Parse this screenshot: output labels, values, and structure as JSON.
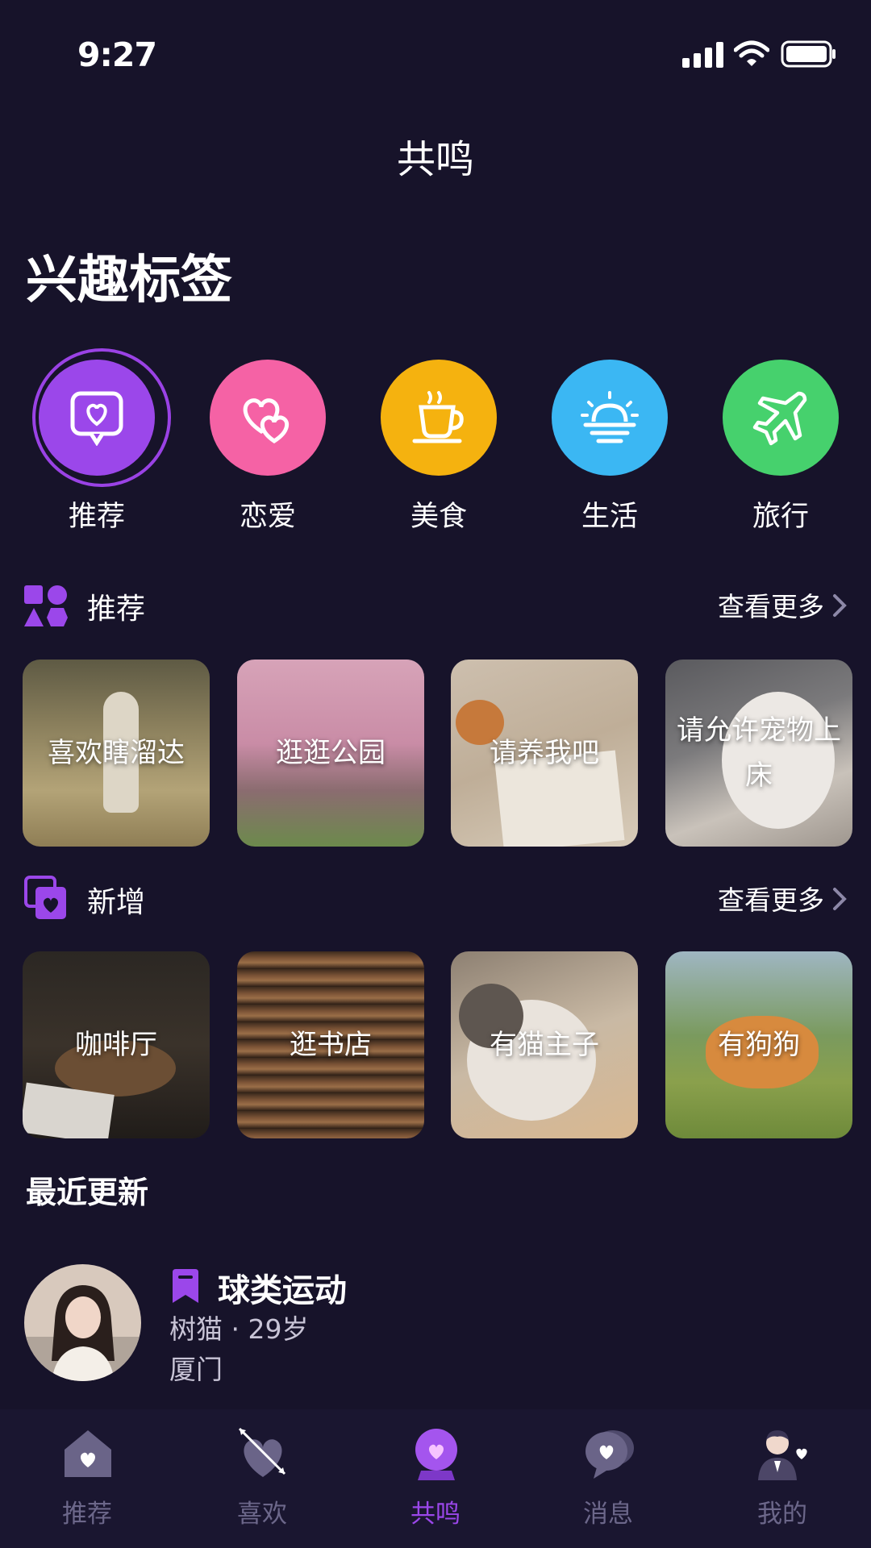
{
  "status_bar": {
    "time": "9:27"
  },
  "nav": {
    "title": "共鸣"
  },
  "interest": {
    "heading": "兴趣标签",
    "categories": [
      {
        "label": "推荐",
        "color": "#9b47ea",
        "icon": "heart-chat-icon",
        "selected": true
      },
      {
        "label": "恋爱",
        "color": "#f562a5",
        "icon": "double-heart-icon"
      },
      {
        "label": "美食",
        "color": "#f5b20f",
        "icon": "coffee-cup-icon"
      },
      {
        "label": "生活",
        "color": "#3bb7f3",
        "icon": "sunrise-icon"
      },
      {
        "label": "旅行",
        "color": "#46d16d",
        "icon": "airplane-icon"
      }
    ]
  },
  "recommend": {
    "title": "推荐",
    "more": "查看更多",
    "icon": "shapes-icon",
    "items": [
      {
        "caption": "喜欢瞎溜达"
      },
      {
        "caption": "逛逛公园"
      },
      {
        "caption": "请养我吧"
      },
      {
        "caption": "请允许宠物上床"
      }
    ]
  },
  "new_section": {
    "title": "新增",
    "more": "查看更多",
    "icon": "heart-cards-icon",
    "items": [
      {
        "caption": "咖啡厅"
      },
      {
        "caption": "逛书店"
      },
      {
        "caption": "有猫主子"
      },
      {
        "caption": "有狗狗"
      }
    ]
  },
  "recent": {
    "title": "最近更新",
    "post": {
      "tag": "球类运动",
      "meta": "树猫 · 29岁",
      "location": "厦门"
    }
  },
  "tabs": [
    {
      "label": "推荐",
      "icon": "house-heart-icon"
    },
    {
      "label": "喜欢",
      "icon": "heart-arrow-icon"
    },
    {
      "label": "共鸣",
      "icon": "crystal-ball-icon",
      "active": true
    },
    {
      "label": "消息",
      "icon": "chat-heart-icon"
    },
    {
      "label": "我的",
      "icon": "user-heart-icon"
    }
  ],
  "colors": {
    "background": "#17132a",
    "accent": "#9b47ea",
    "tab_inactive": "#6c678a"
  }
}
